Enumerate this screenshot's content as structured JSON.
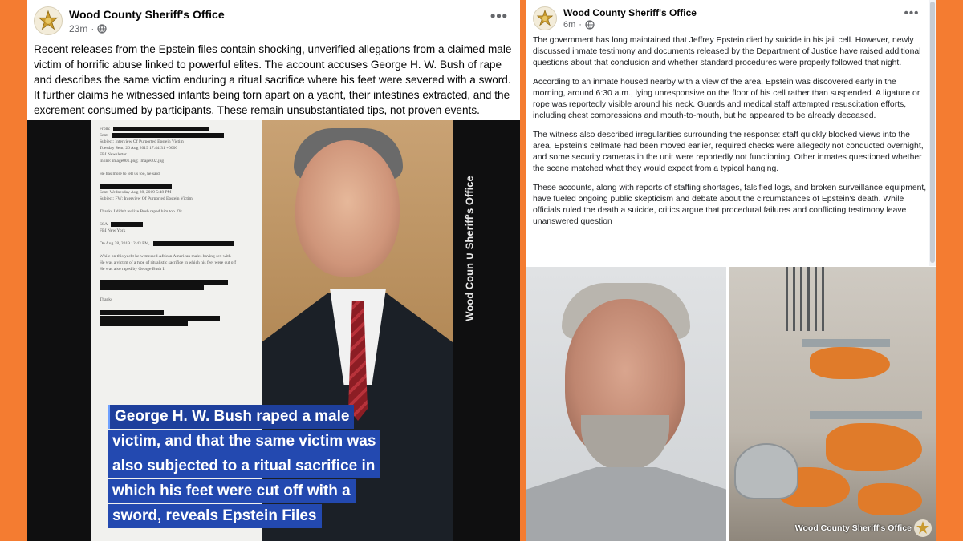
{
  "colors": {
    "background": "#f47c31",
    "overlay_blue": "#2349b0",
    "post_bg": "#ffffff",
    "meta_gray": "#65676b"
  },
  "left_post": {
    "page_name": "Wood County Sheriff's Office",
    "time": "23m",
    "privacy_icon": "globe-icon",
    "more_icon": "ellipsis-icon",
    "caption": "Recent releases from the Epstein files contain shocking, unverified allegations from a claimed male victim of horrific abuse linked to powerful elites. The account accuses George H. W. Bush of rape and describes the same victim enduring a ritual sacrifice where his feet were severed with a sword. It further claims he witnessed infants being torn apart on a yacht, their intestines extracted, and the excrement consumed by participants. These remain unsubstantiated tips, not proven events.",
    "image": {
      "watermark": "Wood Coun ∪ Sheriff's Office",
      "overlay_lines": [
        "George H. W. Bush raped a male",
        "victim, and that the same victim was",
        "also subjected to a ritual sacrifice in",
        "which his feet were cut off with a",
        "sword, reveals  Epstein Files"
      ],
      "document": {
        "from": "From:",
        "sent": "Sent:",
        "subject": "Subject: Interview Of Purported Epstein Victim",
        "date_line": "Tuesday Sent, 26 Aug 2019 17:44:31 +0000",
        "org": "FBI Newsletter",
        "inline": "Inline: image001.png; image002.jpg",
        "note1": "He has more to tell us too, he said.",
        "sent2": "Sent: Wednesday Aug 28, 2019 5:48 PM",
        "subject2": "Subject: FW: Interview Of Purported Epstein Victim",
        "thanks": "Thanks      I didn't realize Bush raped him too. Ok.",
        "ssa": "SSA",
        "office": "FBI New York",
        "on_date": "On Aug 28, 2019 12:43 PM,",
        "bullet1": "While on this yacht he witnessed African American males having sex with",
        "bullet2": "He was a victim of a type of ritualistic sacrifice in which his feet were cut off",
        "bullet3": "He was also raped by George Bush I.",
        "thanks2": "Thanks"
      }
    }
  },
  "right_post": {
    "page_name": "Wood County Sheriff's Office",
    "time": "6m",
    "privacy_icon": "globe-icon",
    "more_icon": "ellipsis-icon",
    "paragraphs": [
      "The government has long maintained that Jeffrey Epstein died by suicide in his jail cell. However, newly discussed inmate testimony and documents released by the Department of Justice have raised additional questions about that conclusion and whether standard procedures were properly followed that night.",
      "According to an inmate housed nearby with a view of the area, Epstein was discovered early in the morning, around 6:30 a.m., lying unresponsive on the floor of his cell rather than suspended. A ligature or rope was reportedly visible around his neck. Guards and medical staff attempted resuscitation efforts, including chest compressions and mouth-to-mouth, but he appeared to be already deceased.",
      "The witness also described irregularities surrounding the response: staff quickly blocked views into the area, Epstein's cellmate had been moved earlier, required checks were allegedly not conducted overnight, and some security cameras in the unit were reportedly not functioning. Other inmates questioned whether the scene matched what they would expect from a typical hanging.",
      "These accounts, along with reports of staffing shortages, falsified logs, and broken surveillance equipment, have fueled ongoing public skepticism and debate about the circumstances of Epstein's death. While officials ruled the death a suicide, critics argue that procedural failures and conflicting testimony leave unanswered question"
    ],
    "image_watermark": "Wood County Sheriff's Office"
  }
}
